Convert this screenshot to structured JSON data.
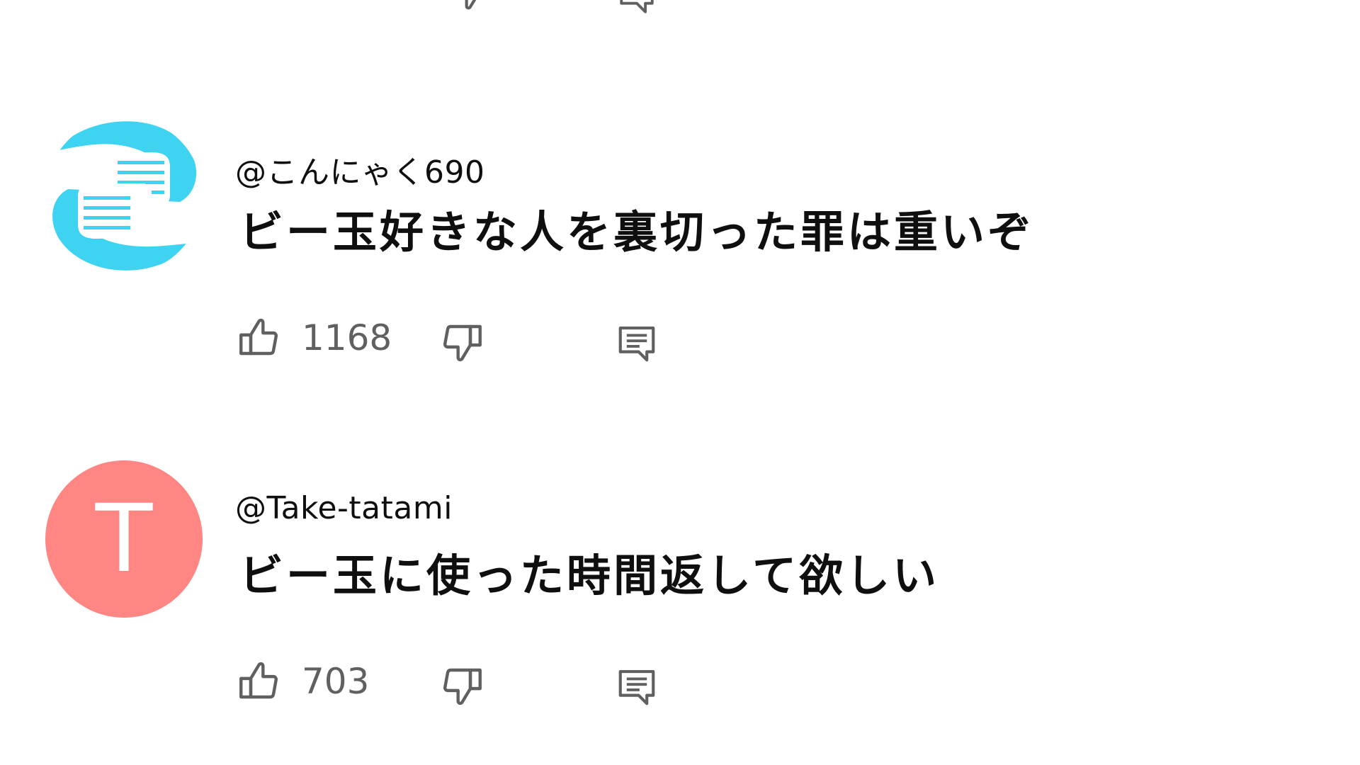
{
  "comments": [
    {
      "author": "@こんにゃく690",
      "text": "ビー玉好きな人を裏切った罪は重いぞ",
      "likes": "1168",
      "avatar": {
        "type": "image",
        "icon": "hands-avatar",
        "color": "#3fd3f2"
      }
    },
    {
      "author": "@Take-tatami",
      "text": "ビー玉に使った時間返して欲しい",
      "likes": "703",
      "avatar": {
        "type": "letter",
        "letter": "T",
        "color": "#ff8683"
      }
    }
  ],
  "icons": {
    "like": "thumbs-up-icon",
    "dislike": "thumbs-down-icon",
    "reply": "comment-reply-icon"
  },
  "colors": {
    "text": "#0f0f0f",
    "muted": "#606060",
    "background": "#ffffff"
  }
}
